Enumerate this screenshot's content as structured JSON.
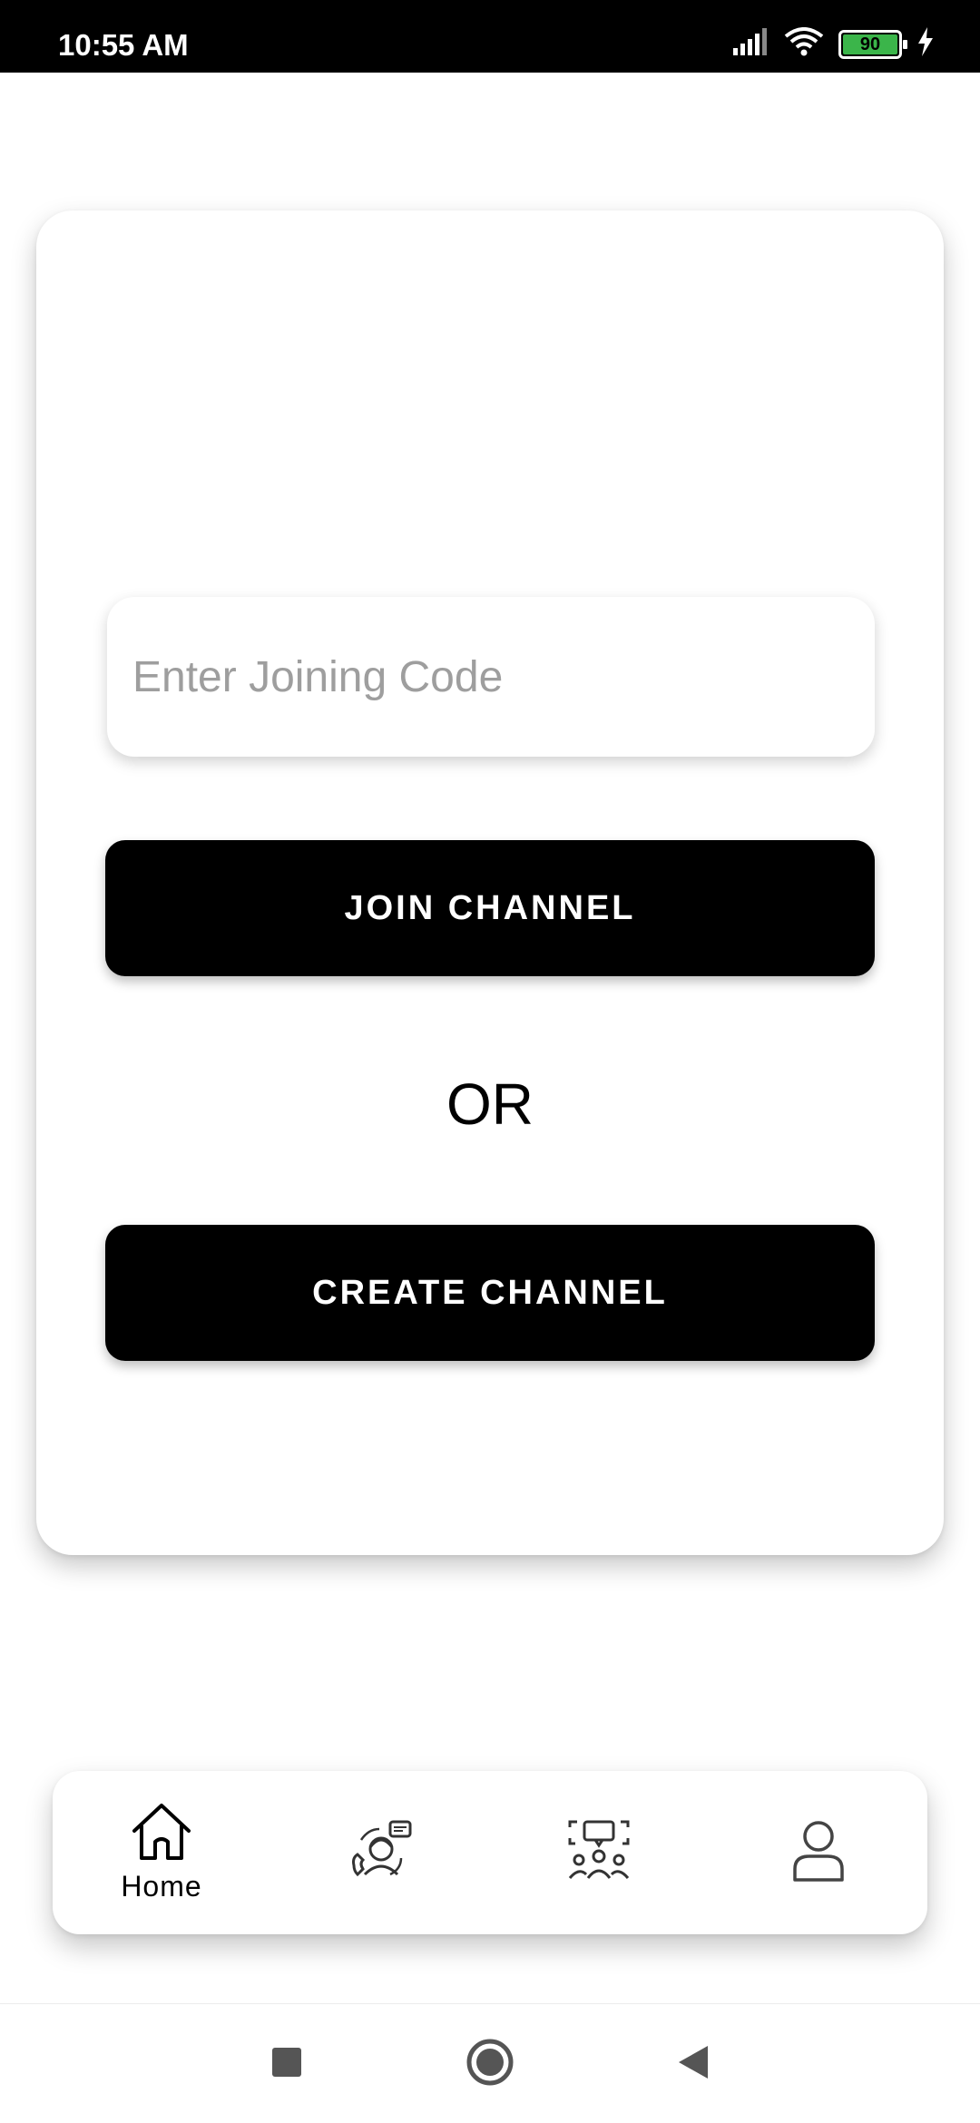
{
  "status_bar": {
    "time": "10:55 AM",
    "battery_level": "90",
    "icons": [
      "signal-icon",
      "wifi-icon",
      "battery-icon",
      "charging-icon"
    ]
  },
  "form": {
    "code_input": {
      "placeholder": "Enter Joining Code",
      "value": ""
    },
    "join_button_label": "JOIN CHANNEL",
    "separator_text": "OR",
    "create_button_label": "CREATE CHANNEL"
  },
  "bottom_nav": {
    "items": [
      {
        "icon": "home-icon",
        "label": "Home",
        "active": true
      },
      {
        "icon": "support-chat-icon"
      },
      {
        "icon": "community-icon"
      },
      {
        "icon": "profile-icon"
      }
    ]
  },
  "system_nav": {
    "icons": [
      "recent-apps-icon",
      "home-circle-icon",
      "back-icon"
    ]
  },
  "colors": {
    "primary_button": "#000000",
    "button_text": "#ffffff",
    "battery_fill": "#3bb54a",
    "placeholder": "#9e9e9e",
    "background": "#ffffff"
  }
}
